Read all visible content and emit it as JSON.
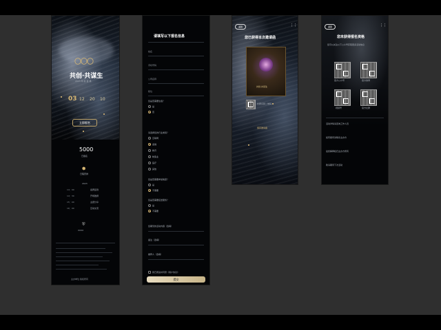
{
  "p1": {
    "logo_text": "〇〇〇",
    "title": "共创·共谋生",
    "subtitle": "2023 年 度 盛 典",
    "countdown": [
      "03",
      "12",
      "20",
      "10"
    ],
    "cta": "立即报名",
    "stat_value": "5000",
    "stat_label": "已报名",
    "section_title": "日程安排",
    "year": "2023",
    "schedule": [
      {
        "time": "14：00",
        "item": "嘉宾签到"
      },
      {
        "time": "14：30",
        "item": "开场致辞"
      },
      {
        "time": "15：00",
        "item": "主题分享"
      },
      {
        "time": "16：00",
        "item": "互动交流"
      }
    ],
    "brand": "XXXX",
    "footer": "主办单位 版权所有"
  },
  "p2": {
    "title": "请填写以下报名信息",
    "fields": [
      "姓名",
      "手机号码",
      "公司名称",
      "职位"
    ],
    "q1": "您是否需要住宿？",
    "q1_opts": [
      "是",
      "否"
    ],
    "q2": "请选择您的行业类别？",
    "q2_opts": [
      "互联网",
      "金融",
      "教育",
      "制造业",
      "医疗",
      "其他"
    ],
    "q3": "您是否需要参加晚宴？",
    "q3_opts": [
      "是",
      "不需要"
    ],
    "q4": "您是否需要接送服务？",
    "q4_opts": [
      "是",
      "不需要"
    ],
    "text1": "您期望的活动内容（选填）",
    "text2": "备注（选填）",
    "text3": "推荐人（选填）",
    "agree": "我已阅读并同意《用户协议》",
    "submit": "提交"
  },
  "p3": {
    "badge": "返回",
    "title": "您已获得本次邀请函",
    "card_caption": "共创·共谋生",
    "qr_text": "长按识别二维码",
    "save": "保存邀请函"
  },
  "p4": {
    "badge": "返回",
    "title": "您未获得报名资格",
    "desc": "您可以关注以下公众号获取更多活动信息",
    "qr_labels": [
      "官方公众号",
      "官方微博",
      "视频号",
      "官方社群"
    ],
    "notes": [
      "活动详情请咨询工作人员",
      "如有疑问请联系主办方",
      "最终解释权归主办方所有",
      "敬请期待下次活动"
    ]
  },
  "colors": {
    "accent": "#d6b673",
    "bg": "#2f2f2f",
    "phone": "#040507"
  }
}
